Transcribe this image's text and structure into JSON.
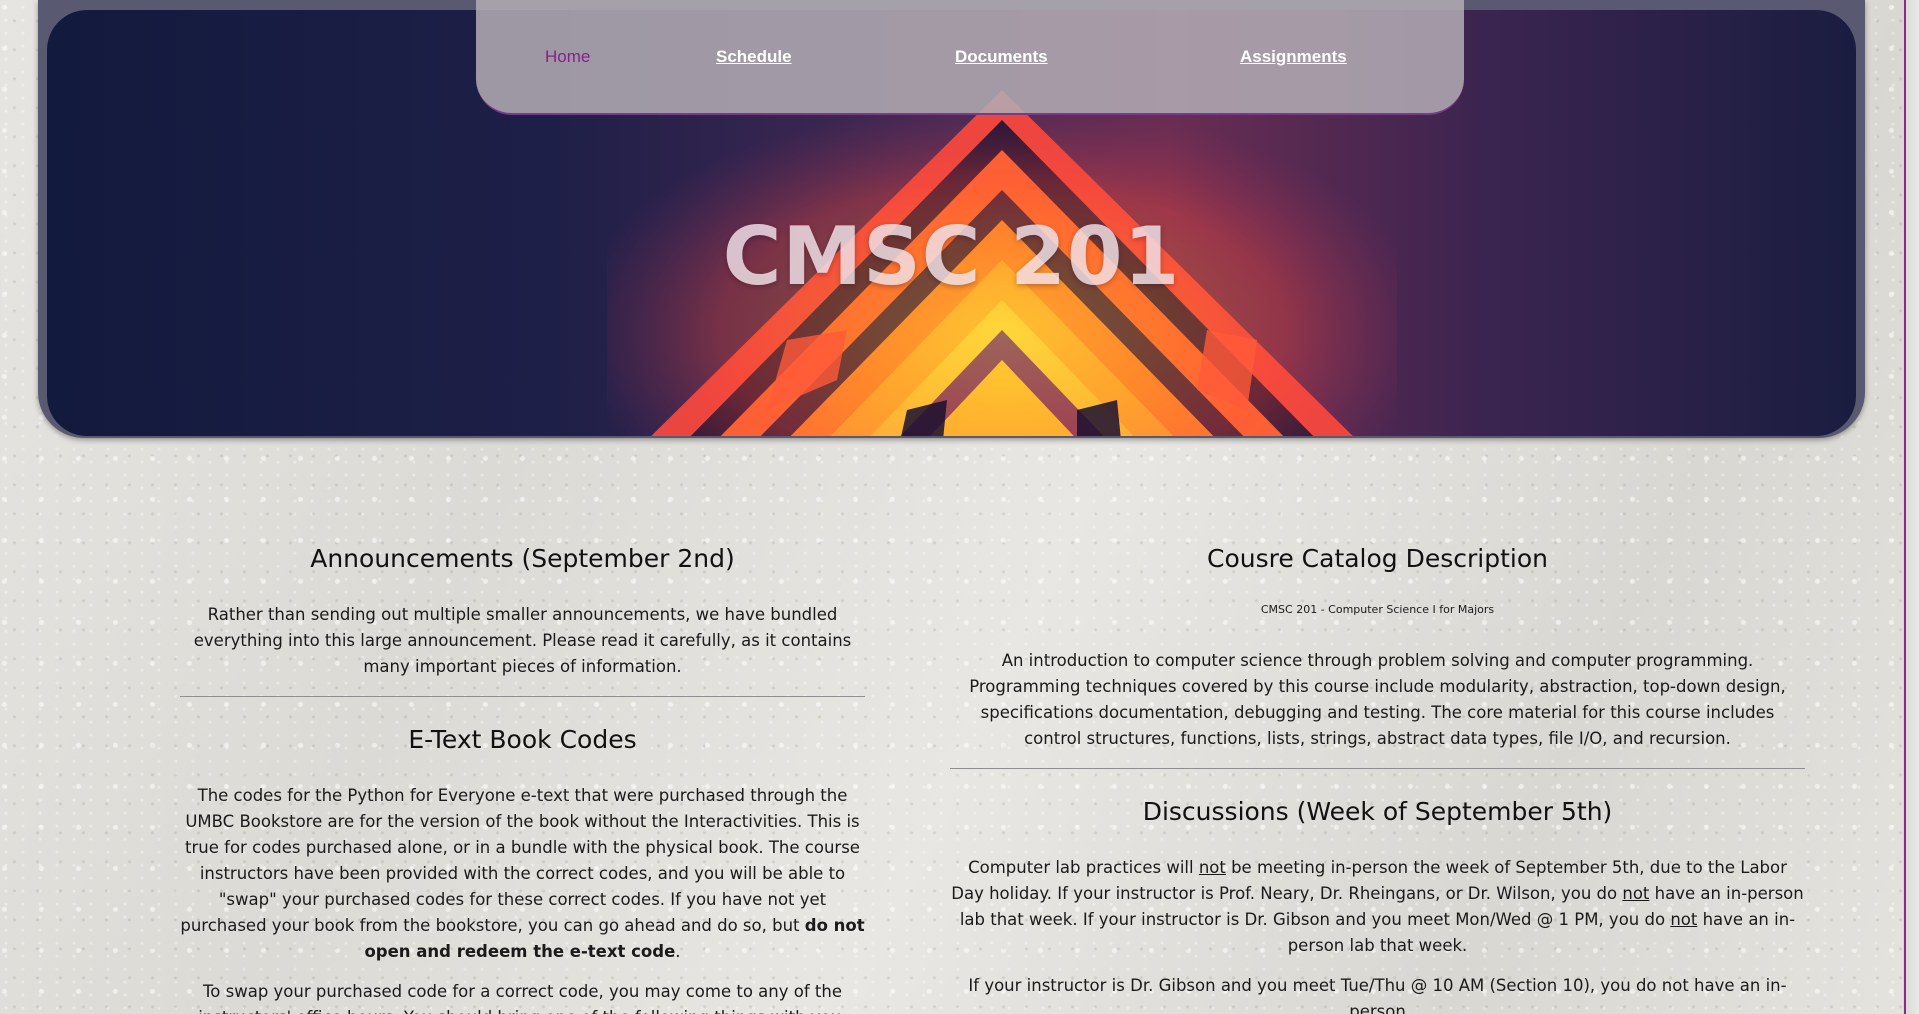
{
  "nav": {
    "items": [
      "Home",
      "Schedule",
      "Documents",
      "Assignments"
    ]
  },
  "hero": {
    "title": "CMSC 201"
  },
  "announcements": {
    "title": "Announcements (September 2nd)",
    "intro": "Rather than sending out multiple smaller announcements, we have bundled everything into this large announcement. Please read it carefully, as it contains many important pieces of information."
  },
  "etext": {
    "title": "E-Text Book Codes",
    "p1_main": "The codes for the Python for Everyone e-text that were purchased through the UMBC Bookstore are for the version of the book without the Interactivities. This is true for codes purchased alone, or in a bundle with the physical book. The course instructors have been provided with the correct codes, and you will be able to \"swap\" your purchased codes for these correct codes. If you have not yet purchased your book from the bookstore, you can go ahead and do so, but ",
    "p1_bold": "do not open and redeem the e-text code",
    "p1_end": ".",
    "p2": "To swap your purchased code for a correct code, you may come to any of the instructors' office hours. You should bring one of the following things with you:"
  },
  "catalog": {
    "title": "Cousre Catalog Description",
    "subtitle": "CMSC 201 - Computer Science I for Majors",
    "body": "An introduction to computer science through problem solving and computer programming. Programming techniques covered by this course include modularity, abstraction, top-down design, specifications documentation, debugging and testing. The core material for this course includes control structures, functions, lists, strings, abstract data types, file I/O, and recursion."
  },
  "discussions": {
    "title": "Discussions (Week of September 5th)",
    "p1_a": "Computer lab practices will ",
    "not": "not",
    "p1_b": " be meeting in-person the week of September 5th, due to the Labor Day holiday. If your instructor is Prof. Neary, Dr. Rheingans, or Dr. Wilson, you do ",
    "p1_c": " have an in-person lab that week. If your instructor is Dr. Gibson and you meet Mon/Wed @ 1 PM, you do ",
    "p1_d": " have an in-person lab that week.",
    "p2": "If your instructor is Dr. Gibson and you meet Tue/Thu @ 10 AM (Section 10), you do not have an in-person"
  },
  "colors": {
    "accent": "#8a1f8a",
    "hero_dark": "#121a3d",
    "hero_magenta": "#6a2d52"
  }
}
